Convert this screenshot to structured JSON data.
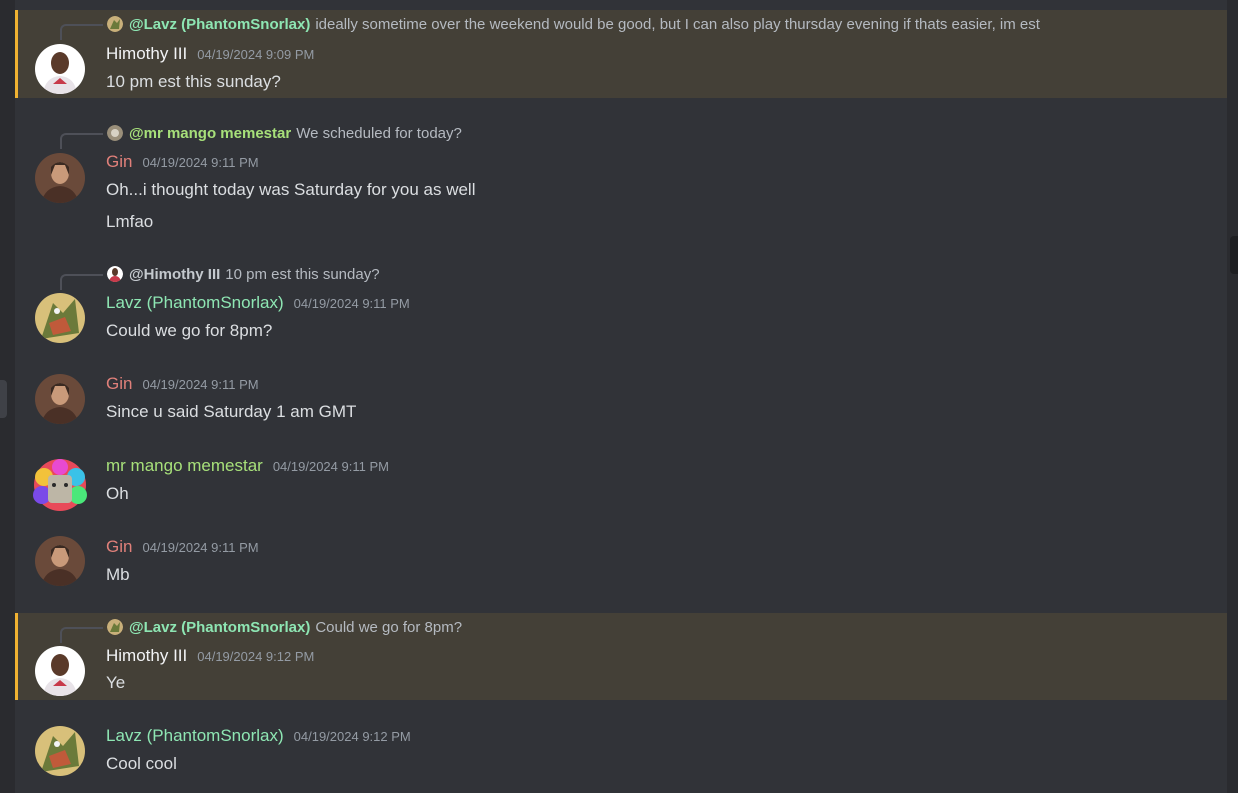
{
  "colors": {
    "himothy": "#f2f3f5",
    "gin": "#e0807a",
    "lavz": "#8ee6b3",
    "mango": "#a7e07a",
    "mention_bg": "#444037",
    "mention_bar": "#f0b232"
  },
  "messages": [
    {
      "reply": {
        "user": "@Lavz (PhantomSnorlax)",
        "text": "ideally sometime over the weekend would be good, but I can also play thursday evening if thats easier, im est"
      },
      "author": "Himothy III",
      "time": "04/19/2024 9:09 PM",
      "lines": [
        "10 pm est this sunday?"
      ]
    },
    {
      "reply": {
        "user": "@mr mango memestar",
        "text": "We scheduled for today?"
      },
      "author": "Gin",
      "time": "04/19/2024 9:11 PM",
      "lines": [
        "Oh...i thought today was Saturday for you as well",
        "Lmfao"
      ]
    },
    {
      "reply": {
        "user": "@Himothy III",
        "text": "10 pm est this sunday?"
      },
      "author": "Lavz (PhantomSnorlax)",
      "time": "04/19/2024 9:11 PM",
      "lines": [
        "Could we go for 8pm?"
      ]
    },
    {
      "author": "Gin",
      "time": "04/19/2024 9:11 PM",
      "lines": [
        "Since u said Saturday 1 am GMT"
      ]
    },
    {
      "author": "mr mango memestar",
      "time": "04/19/2024 9:11 PM",
      "lines": [
        "Oh"
      ]
    },
    {
      "author": "Gin",
      "time": "04/19/2024 9:11 PM",
      "lines": [
        "Mb"
      ]
    },
    {
      "reply": {
        "user": "@Lavz (PhantomSnorlax)",
        "text": "Could we go for 8pm?"
      },
      "author": "Himothy III",
      "time": "04/19/2024 9:12 PM",
      "lines": [
        "Ye"
      ]
    },
    {
      "author": "Lavz (PhantomSnorlax)",
      "time": "04/19/2024 9:12 PM",
      "lines": [
        "Cool cool"
      ]
    }
  ]
}
